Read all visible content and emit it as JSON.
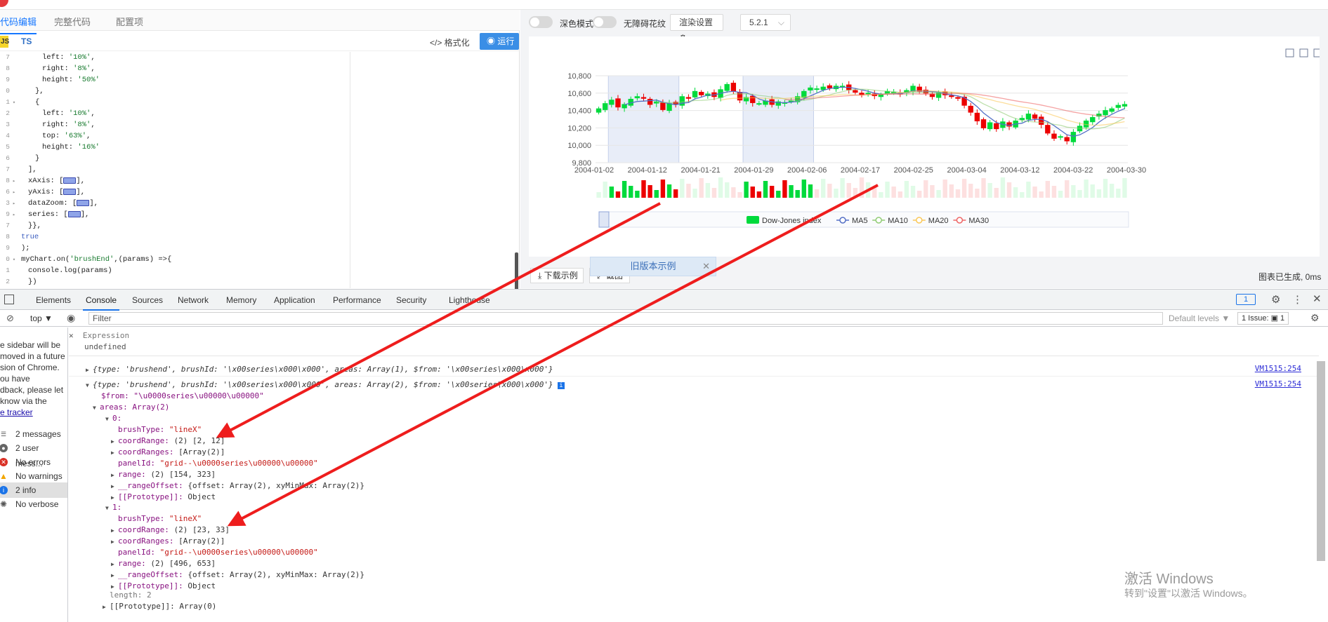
{
  "editor": {
    "tabs": [
      "代码编辑",
      "完整代码",
      "配置项"
    ],
    "lang_js": "JS",
    "lang_ts": "TS",
    "format_label": "</> 格式化",
    "run_label": "运行",
    "lines": [
      {
        "n": "7",
        "text": "left: '10%',"
      },
      {
        "n": "8",
        "text": "right: '8%',"
      },
      {
        "n": "9",
        "text": "height: '50%'"
      },
      {
        "n": "0",
        "text": "},"
      },
      {
        "n": "1",
        "text": "{"
      },
      {
        "n": "2",
        "text": "left: '10%',"
      },
      {
        "n": "3",
        "text": "right: '8%',"
      },
      {
        "n": "4",
        "text": "top: '63%',"
      },
      {
        "n": "5",
        "text": "height: '16%'"
      },
      {
        "n": "6",
        "text": "}"
      },
      {
        "n": "7",
        "text": "],"
      },
      {
        "n": "8",
        "text": "xAxis: ["
      },
      {
        "n": "6",
        "text": "yAxis: ["
      },
      {
        "n": "3",
        "text": "dataZoom: ["
      },
      {
        "n": "9",
        "text": "series: ["
      },
      {
        "n": "7",
        "text": "}},"
      },
      {
        "n": "8",
        "text": "true"
      },
      {
        "n": "9",
        "text": ");"
      },
      {
        "n": "0",
        "text": "myChart.on('brushEnd',(params) =>{"
      },
      {
        "n": "1",
        "text": "console.log(params)"
      },
      {
        "n": "2",
        "text": "})"
      }
    ]
  },
  "chart_panel": {
    "dark_mode_label": "深色模式",
    "no_barrier_label": "无障碍花纹",
    "render_settings_label": "渲染设置 ⚙",
    "version": "5.2.1",
    "download_label": "下载示例",
    "screenshot_label": "截图",
    "old_version_label": "旧版本示例",
    "generated_label": "图表已生成, 0ms"
  },
  "chart_data": {
    "type": "candlestick",
    "y_ticks": [
      "10,800",
      "10,600",
      "10,400",
      "10,200",
      "10,000",
      "9,800"
    ],
    "ylim": [
      9800,
      10800
    ],
    "x_ticks": [
      "2004-01-02",
      "2004-01-12",
      "2004-01-21",
      "2004-01-29",
      "2004-02-06",
      "2004-02-17",
      "2004-02-25",
      "2004-03-04",
      "2004-03-12",
      "2004-03-22",
      "2004-03-30"
    ],
    "legend": [
      "Dow-Jones index",
      "MA5",
      "MA10",
      "MA20",
      "MA30"
    ],
    "colors": {
      "up": "#00da3c",
      "down": "#ec0000",
      "ma5": "#5470c6",
      "ma10": "#91cc75",
      "ma20": "#fac858",
      "ma30": "#ee6666"
    },
    "brush_ranges_index": [
      [
        2,
        12
      ],
      [
        23,
        33
      ]
    ],
    "close": [
      10420,
      10480,
      10520,
      10440,
      10470,
      10530,
      10560,
      10540,
      10470,
      10500,
      10410,
      10480,
      10470,
      10560,
      10540,
      10620,
      10580,
      10590,
      10560,
      10640,
      10700,
      10620,
      10520,
      10550,
      10490,
      10480,
      10510,
      10470,
      10500,
      10490,
      10510,
      10560,
      10620,
      10660,
      10650,
      10670,
      10660,
      10680,
      10680,
      10640,
      10610,
      10580,
      10600,
      10570,
      10580,
      10620,
      10610,
      10590,
      10630,
      10680,
      10620,
      10600,
      10560,
      10600,
      10580,
      10560,
      10540,
      10460,
      10380,
      10280,
      10200,
      10260,
      10190,
      10270,
      10220,
      10280,
      10310,
      10360,
      10310,
      10240,
      10140,
      10080,
      10100,
      10050,
      10150,
      10220,
      10280,
      10320,
      10360,
      10400,
      10420,
      10460,
      10470
    ]
  },
  "devtools": {
    "tabs": [
      "Elements",
      "Console",
      "Sources",
      "Network",
      "Memory",
      "Application",
      "Performance",
      "Security",
      "Lighthouse"
    ],
    "issue_badge": "1",
    "context": "top ▼",
    "filter_placeholder": "Filter",
    "default_levels": "Default levels ▼",
    "issues": "1 Issue: ▣ 1",
    "sidebar_notice": [
      "e sidebar will be",
      "moved in a future",
      "sion of Chrome.",
      "ou have",
      "dback, please let",
      "know via the"
    ],
    "sidebar_link": "e tracker",
    "sidebar_items": [
      {
        "label": "2 messages",
        "icon": "list-icon"
      },
      {
        "label": "2 user mess...",
        "icon": "user-icon"
      },
      {
        "label": "No errors",
        "icon": "error-icon"
      },
      {
        "label": "No warnings",
        "icon": "warning-icon"
      },
      {
        "label": "2 info",
        "icon": "info-icon"
      },
      {
        "label": "No verbose",
        "icon": "verbose-icon"
      }
    ],
    "expression_label": "Expression",
    "expression_value": "undefined",
    "source_link": "VM1515:254",
    "log1": "{type: 'brushend', brushId: '\\x00series\\x000\\x000', areas: Array(1), $from: '\\x00series\\x000\\x000'}",
    "log2": "{type: 'brushend', brushId: '\\x00series\\x000\\x000', areas: Array(2), $from: '\\x00series\\x000\\x000'}",
    "from_line": "$from: \"\\u0000series\\u00000\\u00000\"",
    "areas_line": "areas: Array(2)",
    "area_items": [
      {
        "index": "0:",
        "brushType": "\"lineX\"",
        "coordRange": "(2) [2, 12]",
        "coordRanges": "[Array(2)]",
        "panelId": "\"grid--\\u0000series\\u00000\\u00000\"",
        "range": "(2) [154, 323]",
        "rangeOffset": "{offset: Array(2), xyMinMax: Array(2)}",
        "prototype": "Object"
      },
      {
        "index": "1:",
        "brushType": "\"lineX\"",
        "coordRange": "(2) [23, 33]",
        "coordRanges": "[Array(2)]",
        "panelId": "\"grid--\\u0000series\\u00000\\u00000\"",
        "range": "(2) [496, 653]",
        "rangeOffset": "{offset: Array(2), xyMinMax: Array(2)}",
        "prototype": "Object"
      }
    ],
    "length_line": "length: 2",
    "proto_array": "[[Prototype]]: Array(0)"
  },
  "watermark": {
    "line1": "激活 Windows",
    "line2": "转到\"设置\"以激活 Windows。"
  }
}
